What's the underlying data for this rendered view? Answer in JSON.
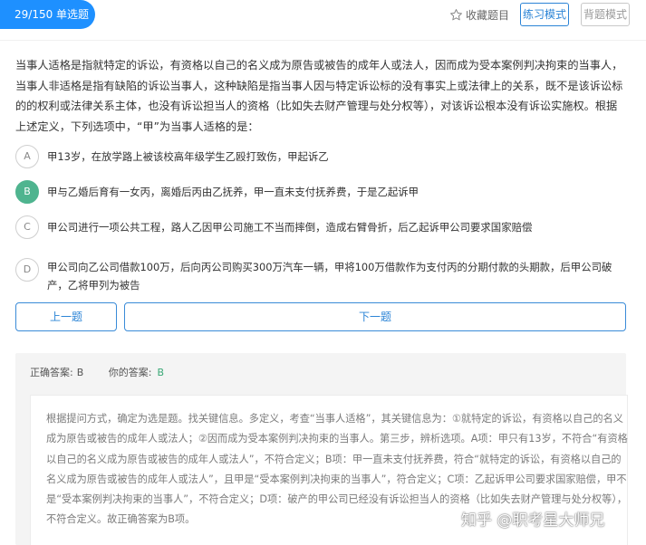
{
  "header": {
    "progress": "29/150 单选题",
    "favorite_label": "收藏题目",
    "practice_mode": "练习模式",
    "recite_mode": "背题模式",
    "accent_color": "#1e90ff"
  },
  "question": {
    "text": "当事人适格是指就特定的诉讼，有资格以自己的名义成为原告或被告的成年人或法人，因而成为受本案例判决拘束的当事人，当事人非适格是指有缺陷的诉讼当事人，这种缺陷是指当事人因与特定诉讼标的没有事实上或法律上的关系，既不是该诉讼标的的权利或法律关系主体，也没有诉讼担当人的资格（比如失去财产管理与处分权等），对该诉讼根本没有诉讼实施权。根据上述定义，下列选项中，“甲”为当事人适格的是："
  },
  "options": [
    {
      "letter": "A",
      "text": "甲13岁，在放学路上被该校高年级学生乙殴打致伤，甲起诉乙",
      "selected": false
    },
    {
      "letter": "B",
      "text": "甲与乙婚后育有一女丙，离婚后丙由乙抚养，甲一直未支付抚养费，于是乙起诉甲",
      "selected": true
    },
    {
      "letter": "C",
      "text": "甲公司进行一项公共工程，路人乙因甲公司施工不当而摔倒，造成右臂骨折，后乙起诉甲公司要求国家赔偿",
      "selected": false
    },
    {
      "letter": "D",
      "text": "甲公司向乙公司借款100万，后向丙公司购买300万汽车一辆，甲将100万借款作为支付丙的分期付款的头期款，后甲公司破产，乙将甲列为被告",
      "selected": false
    }
  ],
  "nav": {
    "prev": "上一题",
    "next": "下一题"
  },
  "answer": {
    "correct_label": "正确答案:",
    "correct_value": "B",
    "your_label": "你的答案:",
    "your_value": "B",
    "correct_color": "#3aa876",
    "analysis": "根据提问方式，确定为选是题。找关键信息。多定义，考查“当事人适格”，其关键信息为：①就特定的诉讼，有资格以自己的名义成为原告或被告的成年人或法人；②因而成为受本案例判决拘束的当事人。第三步，辨析选项。A项：甲只有13岁，不符合“有资格以自己的名义成为原告或被告的成年人或法人”，不符合定义；B项：甲一直未支付抚养费，符合“就特定的诉讼，有资格以自己的名义成为原告或被告的成年人或法人”，且甲是“受本案例判决拘束的当事人”，符合定义；C项：乙起诉甲公司要求国家赔偿，甲不是“受本案例判决拘束的当事人”，不符合定义；D项：破产的甲公司已经没有诉讼担当人的资格（比如失去财产管理与处分权等），不符合定义。故正确答案为B项。"
  },
  "watermark": "知乎 @职考星大师兄"
}
